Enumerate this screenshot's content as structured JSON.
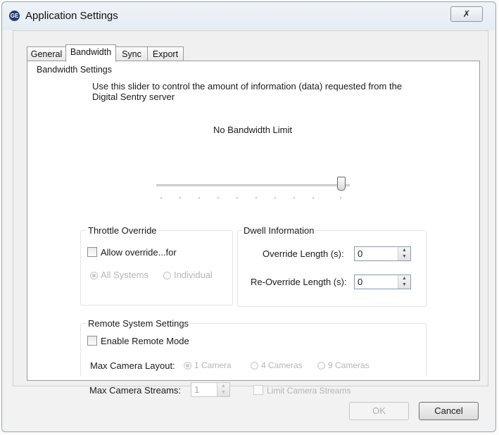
{
  "window": {
    "title": "Application Settings",
    "close_glyph": "✗",
    "icon": "app-logo-icon"
  },
  "tabs": [
    {
      "label": "General",
      "active": false
    },
    {
      "label": "Bandwidth",
      "active": true
    },
    {
      "label": "Sync",
      "active": false
    },
    {
      "label": "Export",
      "active": false
    }
  ],
  "bandwidth": {
    "group_title": "Bandwidth Settings",
    "description_line1": "Use this slider to control the amount of information (data) requested from the",
    "description_line2": "Digital Sentry server",
    "slider_label": "No Bandwidth Limit",
    "slider_level": 1.0
  },
  "throttle": {
    "title": "Throttle Override",
    "allow_label": "Allow override...for",
    "allow_checked": false,
    "options": [
      "All Systems",
      "Individual"
    ],
    "selected": "All Systems"
  },
  "dwell": {
    "title": "Dwell Information",
    "override_label": "Override Length (s):",
    "override_value": "0",
    "reoverride_label": "Re-Override Length (s):",
    "reoverride_value": "0"
  },
  "remote": {
    "title": "Remote System Settings",
    "enable_label": "Enable Remote Mode",
    "enable_checked": false,
    "layout_label": "Max Camera Layout:",
    "layout_options": [
      "1 Camera",
      "4 Cameras",
      "9 Cameras"
    ],
    "layout_selected": "1 Camera",
    "streams_label": "Max Camera Streams:",
    "streams_value": "1",
    "limit_label": "Limit Camera Streams"
  },
  "footer": {
    "ok_label": "OK",
    "cancel_label": "Cancel"
  }
}
